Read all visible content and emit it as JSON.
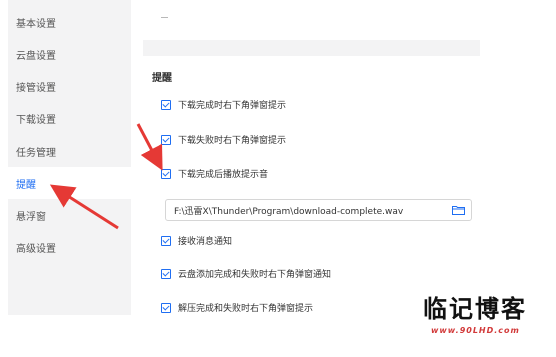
{
  "sidebar": {
    "items": [
      {
        "label": "基本设置"
      },
      {
        "label": "云盘设置"
      },
      {
        "label": "接管设置"
      },
      {
        "label": "下载设置"
      },
      {
        "label": "任务管理"
      },
      {
        "label": "提醒",
        "active": true
      },
      {
        "label": "悬浮窗"
      },
      {
        "label": "高级设置"
      }
    ]
  },
  "reminders": {
    "title": "提醒",
    "options": [
      {
        "label": "下载完成时右下角弹窗提示",
        "checked": true
      },
      {
        "label": "下载失败时右下角弹窗提示",
        "checked": true
      },
      {
        "label": "下载完成后播放提示音",
        "checked": true
      },
      {
        "label": "接收消息通知",
        "checked": true
      },
      {
        "label": "云盘添加完成和失败时右下角弹窗通知",
        "checked": true
      },
      {
        "label": "解压完成和失败时右下角弹窗提示",
        "checked": true
      }
    ],
    "sound_path": "F:\\迅雷X\\Thunder\\Program\\download-complete.wav"
  },
  "watermark": {
    "title": "临记博客",
    "url": "www.90LHD.com"
  },
  "colors": {
    "accent": "#1f6ef2",
    "arrow": "#e53935",
    "sidebar_bg": "#f3f3f4"
  }
}
